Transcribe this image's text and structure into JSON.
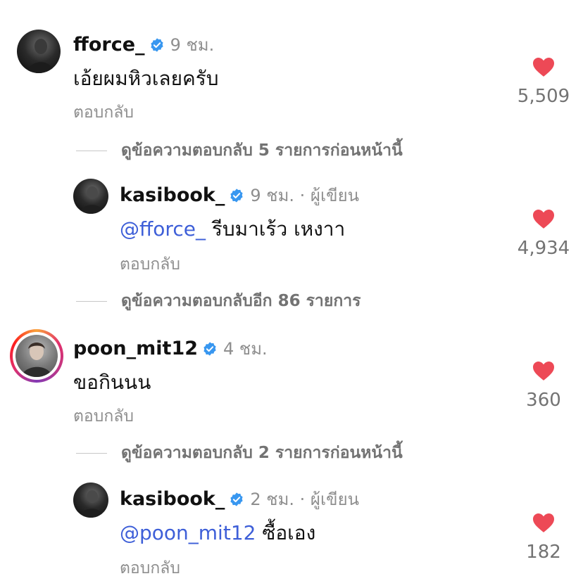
{
  "comments": [
    {
      "username": "fforce_",
      "time": "9 ชม.",
      "author_tag": "",
      "text": "เอ้ยผมหิวเลยครับ",
      "mention": "",
      "reply_label": "ตอบกลับ",
      "likes": "5,509",
      "view_more": "ดูข้อความตอบกลับ 5 รายการก่อนหน้านี้"
    },
    {
      "username": "kasibook_",
      "time": "9 ชม. · ผู้เขียน",
      "mention": "@fforce_",
      "text": "รีบมาเร้ว เหงาา",
      "reply_label": "ตอบกลับ",
      "likes": "4,934",
      "view_more": "ดูข้อความตอบกลับอีก 86 รายการ"
    },
    {
      "username": "poon_mit12",
      "time": "4 ชม.",
      "text": "ขอกินนน",
      "reply_label": "ตอบกลับ",
      "likes": "360",
      "view_more": "ดูข้อความตอบกลับ 2 รายการก่อนหน้านี้"
    },
    {
      "username": "kasibook_",
      "time": "2 ชม. · ผู้เขียน",
      "mention": "@poon_mit12",
      "text": "ซื้อเอง",
      "reply_label": "ตอบกลับ",
      "likes": "182"
    }
  ],
  "colors": {
    "heart": "#ed4956",
    "verified": "#3897f0",
    "mention": "#3e5fd8",
    "secondary_text": "#8e8e8e"
  },
  "icons": [
    "verified-badge-icon",
    "heart-icon",
    "avatar"
  ]
}
